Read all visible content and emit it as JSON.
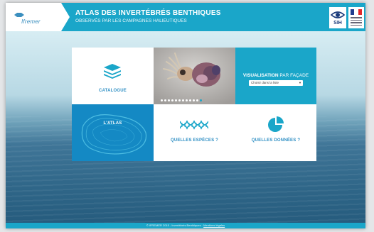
{
  "header": {
    "logo_text": "Ifremer",
    "title": "ATLAS DES INVERTÉBRÉS BENTHIQUES",
    "subtitle": "OBSERVÉS PAR LES CAMPAGNES HALIEUTIQUES",
    "sih_label": "SIH"
  },
  "tiles": {
    "catalogue": {
      "label": "CATALOGUE",
      "icon": "layers-icon"
    },
    "photo": {
      "alt": "squid-photo",
      "slide_count": 12,
      "active_slide": 12
    },
    "visualisation": {
      "label_bold": "VISUALISATION",
      "label_rest": " PAR FAÇADE",
      "select_placeholder": "Choisir dans la liste"
    },
    "atlas": {
      "label": "L'ATLAS"
    },
    "especes": {
      "label": "QUELLES ESPÈCES ?",
      "icon": "dna-icon"
    },
    "donnees": {
      "label": "QUELLES DONNÉES ?",
      "icon": "pie-chart-icon"
    }
  },
  "footer": {
    "text": "© IFREMER 2015 - Invertébrés Benthiques - ",
    "link": "Mentions légales"
  },
  "colors": {
    "accent": "#1aa6c9",
    "atlas_blue": "#1489c4",
    "label_blue": "#2f8fc4"
  }
}
